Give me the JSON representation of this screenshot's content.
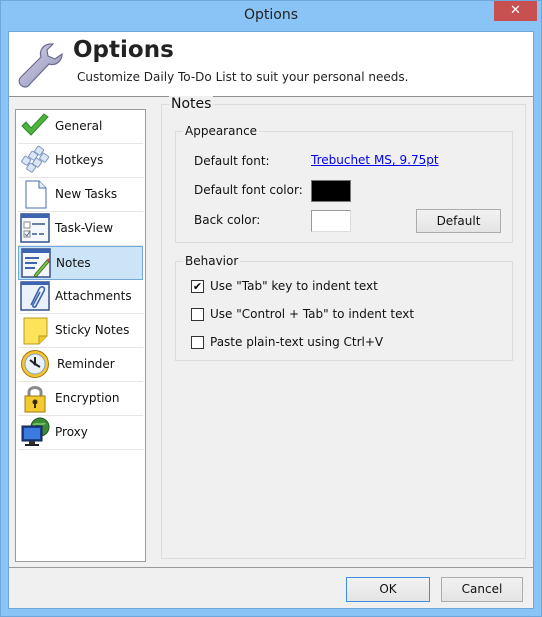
{
  "window": {
    "title": "Options",
    "close_icon": "close-icon",
    "close_glyph": "✕"
  },
  "header": {
    "icon": "wrench-icon",
    "title": "Options",
    "subtitle": "Customize Daily To-Do List to suit your personal needs."
  },
  "sidebar": {
    "selected": "Notes",
    "items": [
      {
        "label": "General",
        "icon": "checkmark-icon"
      },
      {
        "label": "Hotkeys",
        "icon": "keyboard-keys-icon"
      },
      {
        "label": "New Tasks",
        "icon": "blank-document-icon"
      },
      {
        "label": "Task-View",
        "icon": "task-view-icon"
      },
      {
        "label": "Notes",
        "icon": "notes-pencil-icon"
      },
      {
        "label": "Attachments",
        "icon": "paperclip-icon"
      },
      {
        "label": "Sticky Notes",
        "icon": "sticky-note-icon"
      },
      {
        "label": "Reminder",
        "icon": "clock-icon"
      },
      {
        "label": "Encryption",
        "icon": "padlock-icon"
      },
      {
        "label": "Proxy",
        "icon": "network-monitor-icon"
      }
    ]
  },
  "notes": {
    "title": "Notes",
    "appearance": {
      "legend": "Appearance",
      "default_font_label": "Default font:",
      "default_font_value": "Trebuchet MS, 9.75pt",
      "default_font_color_label": "Default font color:",
      "default_font_color": "#000000",
      "back_color_label": "Back color:",
      "back_color": "#ffffff",
      "default_button": "Default"
    },
    "behavior": {
      "legend": "Behavior",
      "options": [
        {
          "label": "Use \"Tab\" key to indent text",
          "checked": true
        },
        {
          "label": "Use \"Control + Tab\" to indent text",
          "checked": false
        },
        {
          "label": "Paste plain-text using Ctrl+V",
          "checked": false
        }
      ]
    }
  },
  "footer": {
    "ok_label": "OK",
    "cancel_label": "Cancel"
  },
  "colors": {
    "frame": "#8ac4f7",
    "close_button": "#c75050",
    "selection": "#cce4f7",
    "link": "#0000ee"
  }
}
